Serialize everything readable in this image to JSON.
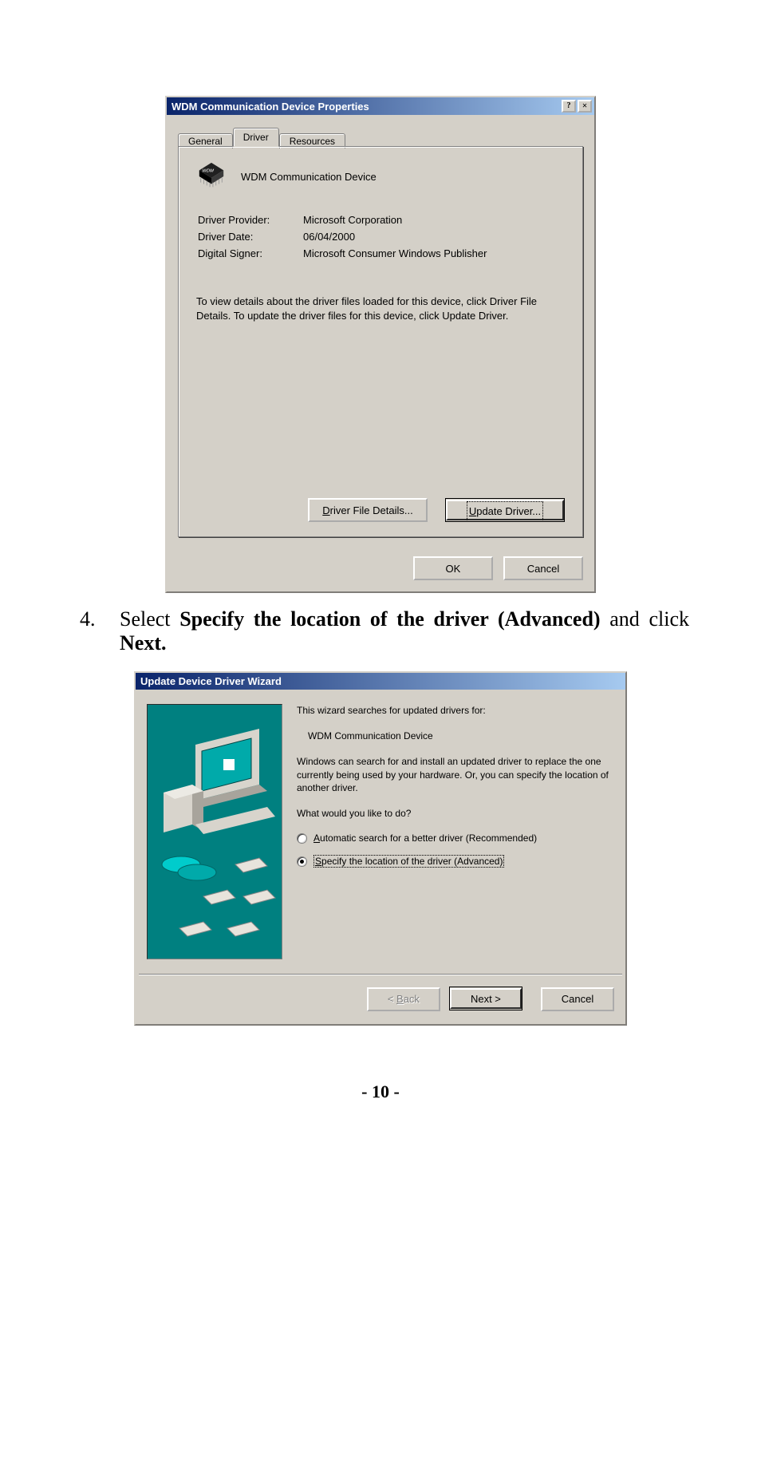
{
  "dlg1": {
    "title": "WDM Communication Device Properties",
    "tabs": {
      "general": "General",
      "driver": "Driver",
      "resources": "Resources"
    },
    "deviceName": "WDM Communication Device",
    "rows": {
      "providerLabel": "Driver Provider:",
      "providerValue": "Microsoft Corporation",
      "dateLabel": "Driver Date:",
      "dateValue": "06/04/2000",
      "signerLabel": "Digital Signer:",
      "signerValue": "Microsoft Consumer Windows Publisher"
    },
    "helptext": "To view details about the driver files loaded for this device, click Driver File Details.  To update the driver files for this device, click Update Driver.",
    "btnDetailsPrefix": "D",
    "btnDetailsRest": "river File Details...",
    "btnUpdatePrefix": "U",
    "btnUpdateRest": "pdate Driver...",
    "ok": "OK",
    "cancel": "Cancel"
  },
  "instruction": {
    "num": "4.",
    "plain1": "Select ",
    "bold1": "Specify the location of the driver (Advanced)",
    "plain2": " and click ",
    "bold2": "Next."
  },
  "dlg2": {
    "title": "Update Device Driver Wizard",
    "p1": "This wizard searches for updated drivers for:",
    "device": "WDM Communication Device",
    "p2": "Windows can search for and install an updated driver to replace the one currently being used by your hardware. Or, you can specify the location of another driver.",
    "p3": "What would you like to do?",
    "opt1Prefix": "A",
    "opt1Rest": "utomatic search for a better driver (Recommended)",
    "opt2Prefix": "S",
    "opt2Rest": "pecify the location of the driver (Advanced)",
    "backPrefix": "< ",
    "backU": "B",
    "backRest": "ack",
    "next": "Next >",
    "cancel": "Cancel"
  },
  "pageNumber": "- 10 -"
}
